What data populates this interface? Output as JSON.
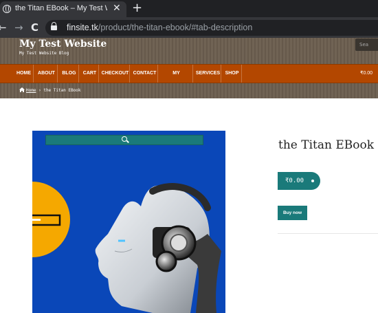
{
  "browser": {
    "tab_title": "the Titan EBook – My Test Website",
    "tab_close": "✕",
    "new_tab": "+",
    "back": "←",
    "forward": "→",
    "reload": "C",
    "url_host": "finsite.tk",
    "url_path": "/product/the-titan-ebook/#tab-description"
  },
  "site": {
    "title": "My Test Website",
    "tagline": "My Test Website Blog",
    "search_placeholder": "Sea"
  },
  "nav": {
    "items": [
      "HOME",
      "ABOUT",
      "BLOG",
      "CART",
      "CHECKOUT",
      "CONTACT",
      "MY ACCOUNT",
      "SERVICES",
      "SHOP"
    ],
    "cart_total": "₹0.00"
  },
  "breadcrumb": {
    "home": "Home",
    "separator": "›",
    "current": "the Titan EBook"
  },
  "product": {
    "title": "the Titan EBook",
    "price": "₹0.00",
    "buy_label": "Buy now"
  },
  "colors": {
    "nav_bg": "#b34700",
    "accent": "#1a7a7a",
    "header_bg": "#6b5e4f",
    "image_bg": "#0a47b8"
  }
}
